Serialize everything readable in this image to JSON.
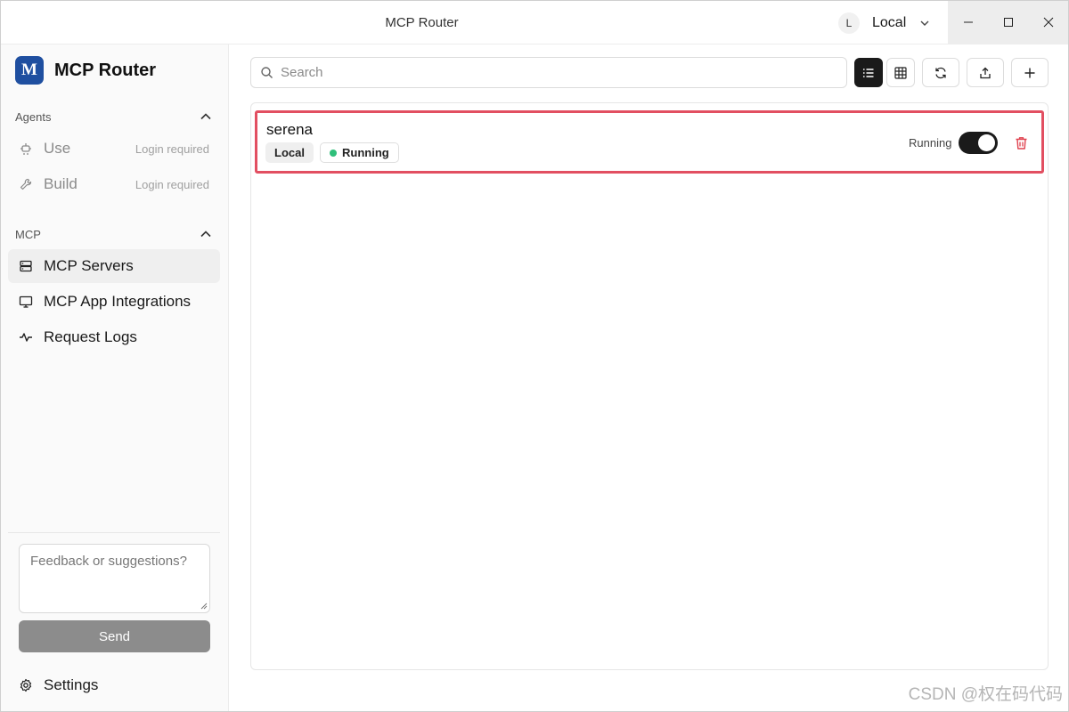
{
  "window": {
    "title": "MCP Router",
    "workspace": {
      "avatar_letter": "L",
      "name": "Local"
    },
    "controls": [
      "minimize-icon",
      "maximize-icon",
      "close-icon"
    ]
  },
  "sidebar": {
    "brand": {
      "logo_letter": "M",
      "name": "MCP Router",
      "logo_color": "#1f4fa0"
    },
    "agents_section": {
      "label": "Agents",
      "items": [
        {
          "label": "Use",
          "hint": "Login required",
          "icon": "bot-icon"
        },
        {
          "label": "Build",
          "hint": "Login required",
          "icon": "wrench-icon"
        }
      ]
    },
    "mcp_section": {
      "label": "MCP",
      "items": [
        {
          "label": "MCP Servers",
          "icon": "server-icon",
          "active": true
        },
        {
          "label": "MCP App Integrations",
          "icon": "monitor-icon"
        },
        {
          "label": "Request Logs",
          "icon": "activity-icon"
        }
      ]
    },
    "feedback": {
      "placeholder": "Feedback or suggestions?",
      "send_label": "Send"
    },
    "settings_label": "Settings"
  },
  "main": {
    "search": {
      "placeholder": "Search",
      "value": ""
    },
    "toolbar": [
      "list-view-icon",
      "grid-view-icon",
      "refresh-icon",
      "export-icon",
      "plus-icon"
    ],
    "servers": [
      {
        "name": "serena",
        "tags": {
          "scope": "Local",
          "status": "Running"
        },
        "state_label": "Running",
        "enabled": true,
        "status_color": "#2fbf7a"
      }
    ]
  },
  "highlight_color": "#e24f61",
  "watermark": "CSDN @权在码代码"
}
